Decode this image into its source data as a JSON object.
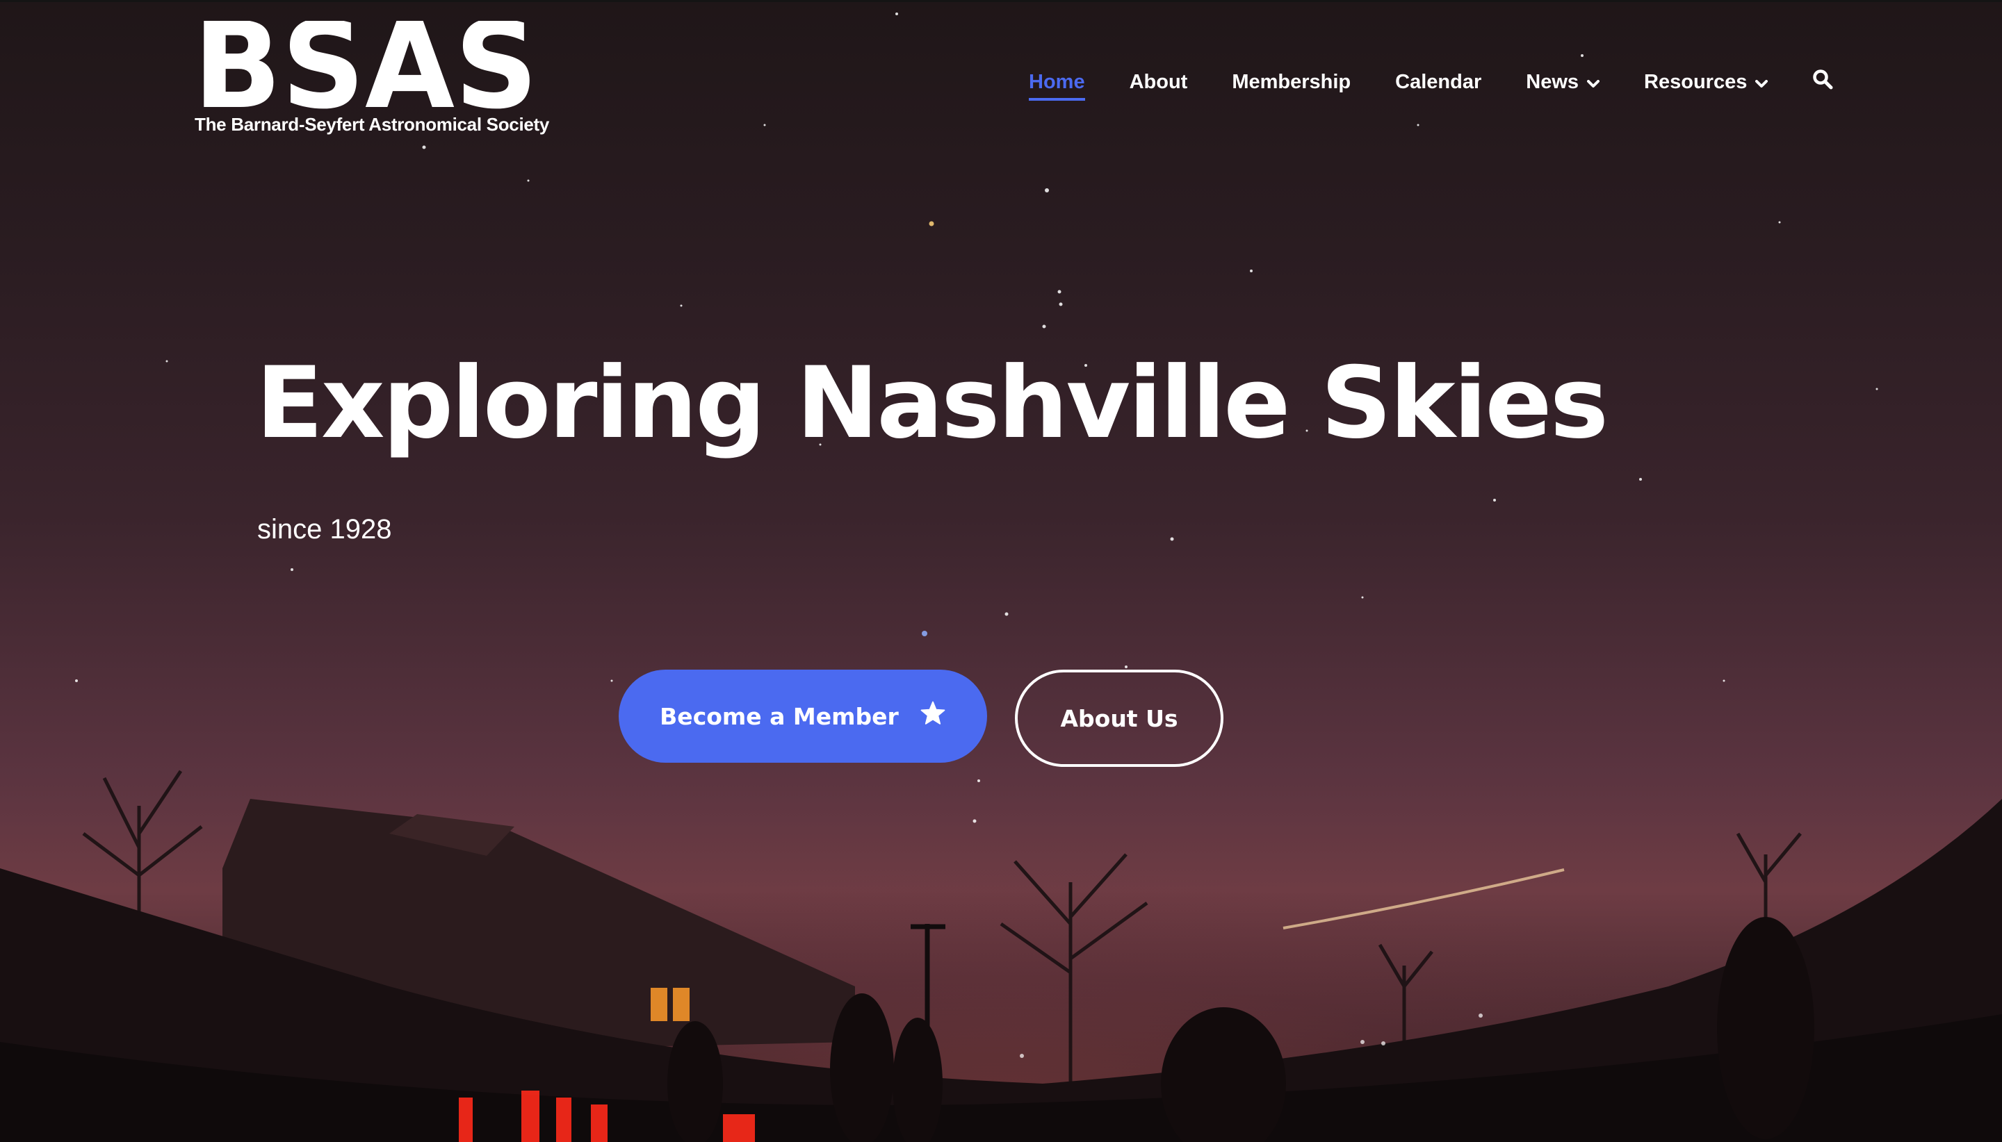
{
  "logo": {
    "wordmark": "BSAS",
    "tagline": "The Barnard-Seyfert Astronomical Society"
  },
  "nav": {
    "items": [
      {
        "label": "Home",
        "active": true
      },
      {
        "label": "About"
      },
      {
        "label": "Membership"
      },
      {
        "label": "Calendar"
      },
      {
        "label": "News",
        "has_dropdown": true
      },
      {
        "label": "Resources",
        "has_dropdown": true
      }
    ],
    "search_icon": "search-icon"
  },
  "hero": {
    "title": "Exploring Nashville Skies",
    "subtitle": "since 1928",
    "primary_button": {
      "label": "Become a Member",
      "icon": "star-icon"
    },
    "secondary_button": {
      "label": "About Us"
    }
  },
  "colors": {
    "accent": "#4b6af0",
    "text": "#ffffff"
  }
}
